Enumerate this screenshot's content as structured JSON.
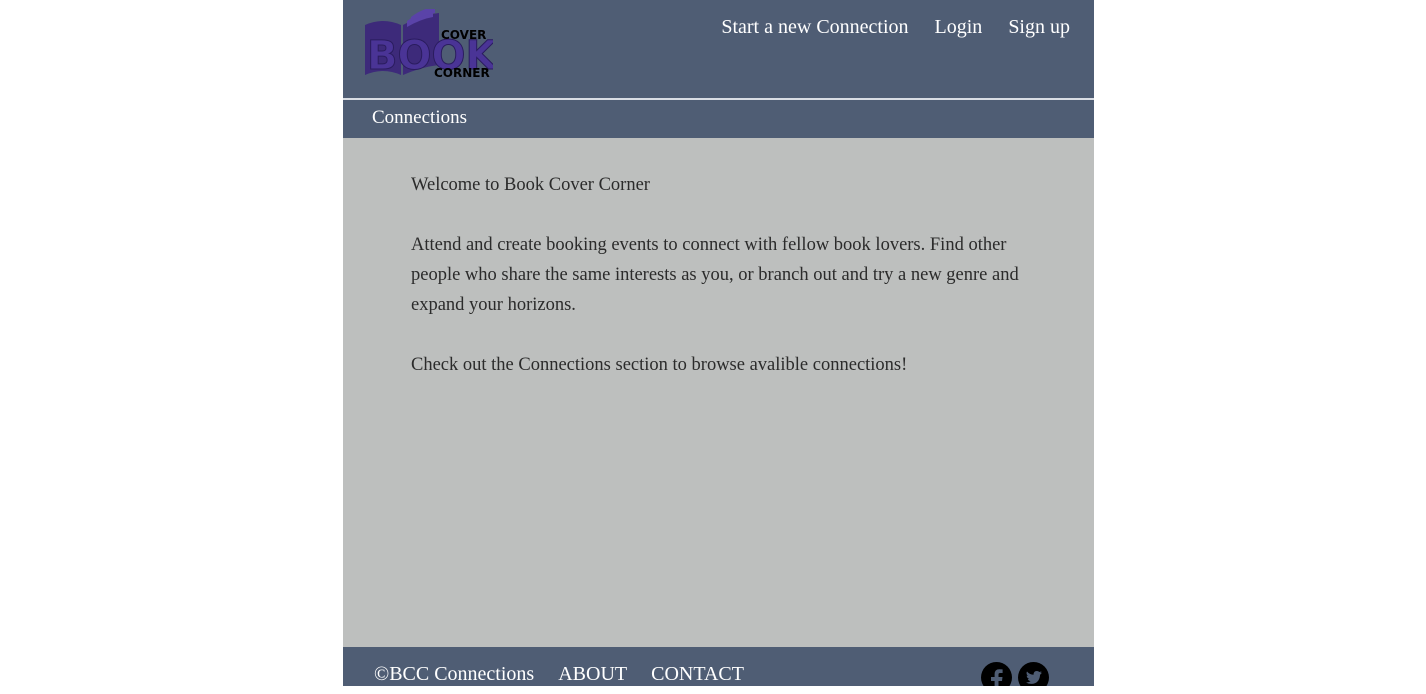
{
  "header": {
    "logo": {
      "text_cover": "COVER",
      "text_book": "BOOK",
      "text_corner": "CORNER",
      "icon": "open-book-icon",
      "color": "#3d2a7a"
    },
    "nav": [
      {
        "label": "Start a new Connection"
      },
      {
        "label": "Login"
      },
      {
        "label": "Sign up"
      }
    ]
  },
  "subnav": {
    "label": "Connections"
  },
  "main": {
    "paragraphs": [
      "Welcome to Book Cover Corner",
      "Attend and create booking events to connect with fellow book lovers. Find other people who share the same interests as you, or branch out and try a new genre and expand your horizons.",
      "Check out the Connections section to browse avalible connections!"
    ]
  },
  "footer": {
    "copyright": "©BCC Connections",
    "links": [
      "ABOUT",
      "CONTACT"
    ],
    "social": [
      {
        "icon": "facebook-icon"
      },
      {
        "icon": "twitter-icon"
      }
    ]
  },
  "colors": {
    "header_bg": "#4f5d74",
    "content_bg": "#bdbfbe",
    "text": "#2b2b2b"
  }
}
